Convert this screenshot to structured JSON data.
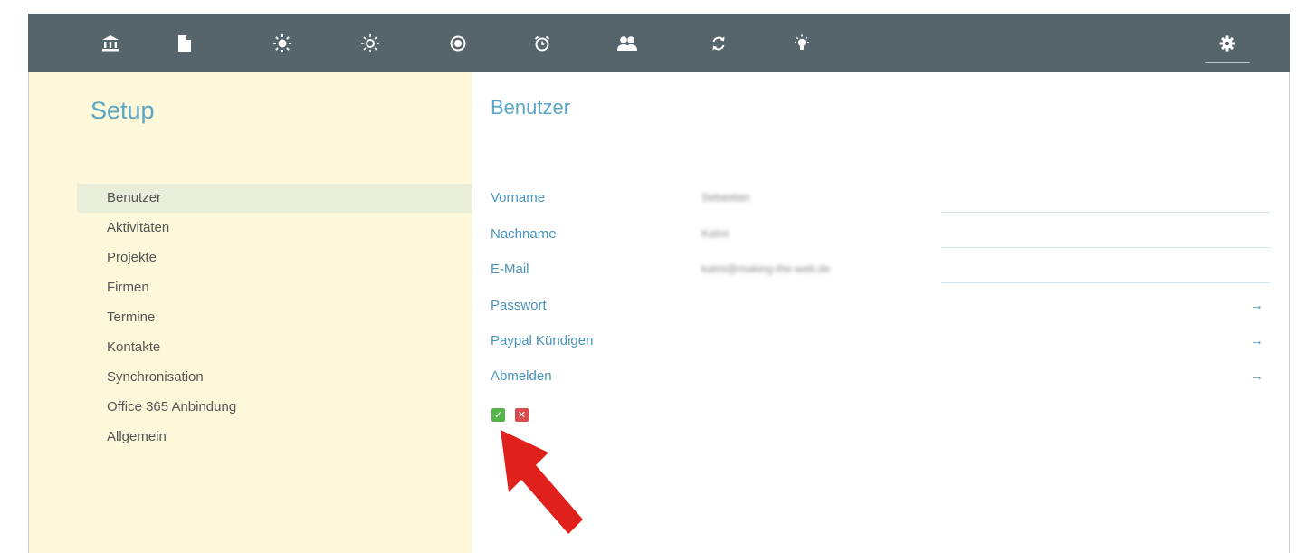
{
  "nav": {
    "icons": [
      {
        "name": "bank-icon"
      },
      {
        "name": "document-icon"
      },
      {
        "name": "sun-filled-icon"
      },
      {
        "name": "sun-outline-icon"
      },
      {
        "name": "record-icon"
      },
      {
        "name": "alarm-clock-icon"
      },
      {
        "name": "users-icon"
      },
      {
        "name": "sync-icon"
      },
      {
        "name": "lightbulb-icon"
      },
      {
        "name": "gear-icon",
        "active": true
      }
    ]
  },
  "sidebar": {
    "title": "Setup",
    "items": [
      {
        "label": "Benutzer",
        "active": true
      },
      {
        "label": "Aktivitäten"
      },
      {
        "label": "Projekte"
      },
      {
        "label": "Firmen"
      },
      {
        "label": "Termine"
      },
      {
        "label": "Kontakte"
      },
      {
        "label": "Synchronisation"
      },
      {
        "label": "Office 365 Anbindung"
      },
      {
        "label": "Allgemein"
      }
    ]
  },
  "main": {
    "title": "Benutzer",
    "fields": [
      {
        "label": "Vorname",
        "value": "Sebastian"
      },
      {
        "label": "Nachname",
        "value": "Kalmi"
      },
      {
        "label": "E-Mail",
        "value": "kalmi@making-the-web.de"
      }
    ],
    "links": [
      {
        "label": "Passwort",
        "arrow": "→"
      },
      {
        "label": "Paypal Kündigen",
        "arrow": "→"
      },
      {
        "label": "Abmelden",
        "arrow": "→"
      }
    ],
    "confirm_symbol": "✓",
    "cancel_symbol": "✕"
  },
  "colors": {
    "topbar": "#56656b",
    "sidebar_bg": "#fdf8da",
    "active_item_bg": "#e8eed9",
    "accent": "#5aa6c6",
    "confirm": "#56b44a",
    "cancel": "#d94a4a",
    "annotation_arrow": "#e0211b"
  }
}
